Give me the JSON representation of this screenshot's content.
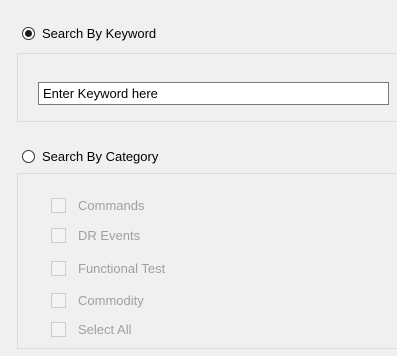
{
  "keyword_option": {
    "label": "Search By Keyword",
    "selected": true
  },
  "keyword_input": {
    "value": "Enter Keyword here"
  },
  "category_option": {
    "label": "Search By Category",
    "selected": false
  },
  "categories": [
    {
      "label": "Commands",
      "checked": false,
      "enabled": false
    },
    {
      "label": "DR Events",
      "checked": false,
      "enabled": false
    },
    {
      "label": "Functional Test",
      "checked": false,
      "enabled": false
    },
    {
      "label": "Commodity",
      "checked": false,
      "enabled": false
    },
    {
      "label": "Select All",
      "checked": false,
      "enabled": false
    }
  ]
}
